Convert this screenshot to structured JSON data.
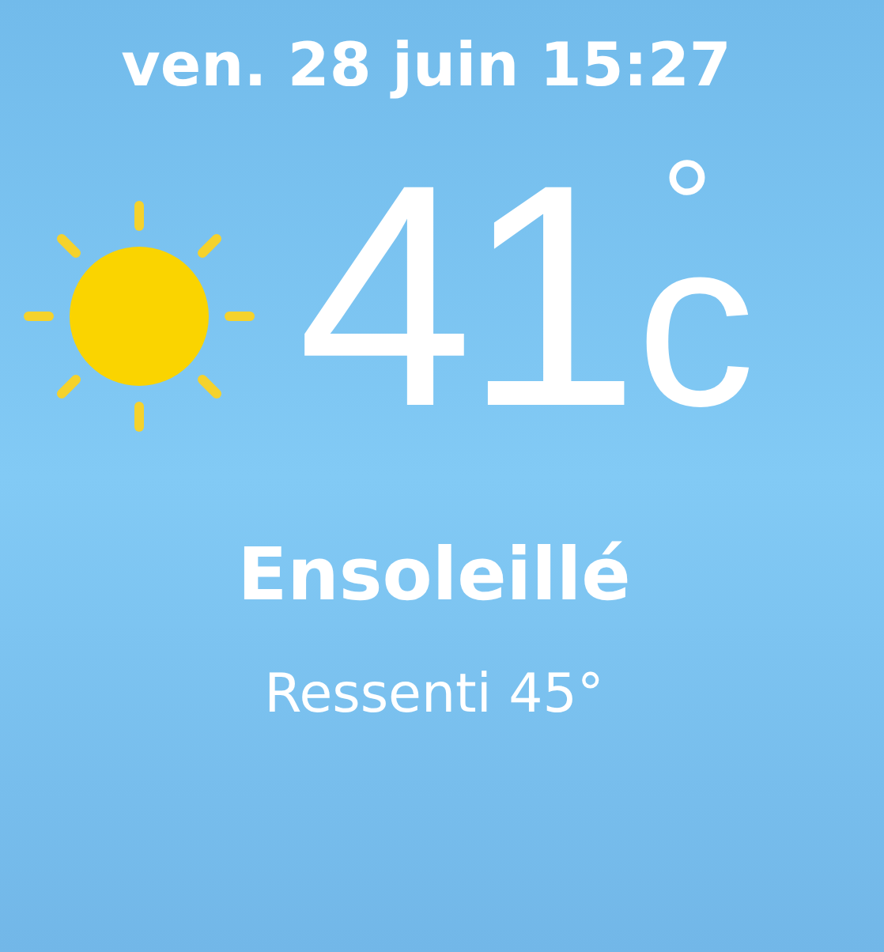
{
  "date": "ven. 28 juin 15:27",
  "temperature": {
    "value": "41",
    "degree": "°",
    "unit": "c"
  },
  "condition": {
    "kind": "sunny",
    "label": "Ensoleillé"
  },
  "feels_like": "Ressenti 45°"
}
